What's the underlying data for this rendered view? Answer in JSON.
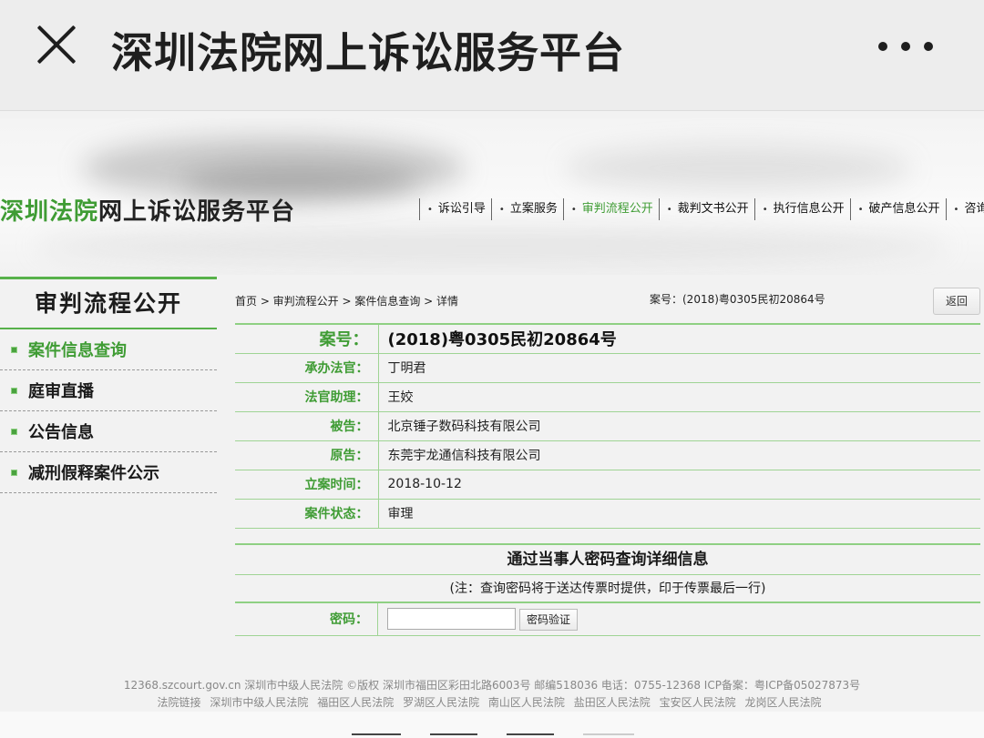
{
  "appbar": {
    "title": "深圳法院网上诉讼服务平台"
  },
  "site": {
    "logo_green": "深圳法院",
    "logo_dark": "网上诉讼服务平台",
    "nav": [
      {
        "label": "诉讼引导",
        "active": false
      },
      {
        "label": "立案服务",
        "active": false
      },
      {
        "label": "审判流程公开",
        "active": true
      },
      {
        "label": "裁判文书公开",
        "active": false
      },
      {
        "label": "执行信息公开",
        "active": false
      },
      {
        "label": "破产信息公开",
        "active": false
      },
      {
        "label": "咨询帮助",
        "active": false
      }
    ]
  },
  "sidebar": {
    "title": "审判流程公开",
    "items": [
      {
        "label": "案件信息查询",
        "active": true
      },
      {
        "label": "庭审直播",
        "active": false
      },
      {
        "label": "公告信息",
        "active": false
      },
      {
        "label": "减刑假释案件公示",
        "active": false
      }
    ]
  },
  "main": {
    "breadcrumb": "首页 > 审判流程公开 > 案件信息查询 > 详情",
    "case_no_header": "案号：(2018)粤0305民初20864号",
    "back_label": "返回",
    "fields": [
      {
        "key": "案号：",
        "value": "(2018)粤0305民初20864号"
      },
      {
        "key": "承办法官：",
        "value": "丁明君"
      },
      {
        "key": "法官助理：",
        "value": "王姣"
      },
      {
        "key": "被告：",
        "value": "北京锤子数码科技有限公司"
      },
      {
        "key": "原告：",
        "value": "东莞宇龙通信科技有限公司"
      },
      {
        "key": "立案时间：",
        "value": "2018-10-12"
      },
      {
        "key": "案件状态：",
        "value": "审理"
      }
    ],
    "password": {
      "title": "通过当事人密码查询详细信息",
      "note": "(注：查询密码将于送达传票时提供，印于传票最后一行)",
      "label": "密码：",
      "value": "",
      "verify_label": "密码验证"
    }
  },
  "footer": {
    "line1": "12368.szcourt.gov.cn 深圳市中级人民法院 ©版权 深圳市福田区彩田北路6003号 邮编518036 电话：0755-12368  ICP备案：粤ICP备05027873号",
    "links_label": "法院链接",
    "links": [
      "深圳市中级人民法院",
      "福田区人民法院",
      "罗湖区人民法院",
      "南山区人民法院",
      "盐田区人民法院",
      "宝安区人民法院",
      "龙岗区人民法院"
    ]
  }
}
